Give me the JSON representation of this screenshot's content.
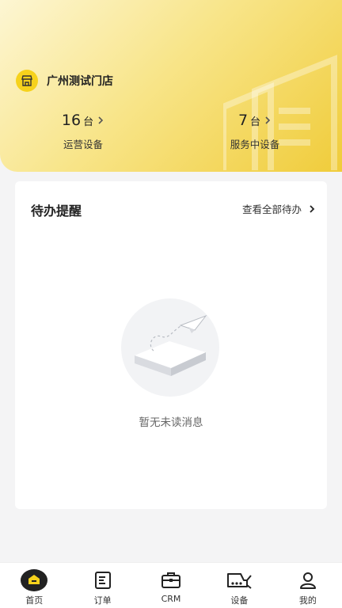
{
  "store": {
    "name": "广州测试门店",
    "icon": "store-icon"
  },
  "stats": [
    {
      "value": "16",
      "unit": "台",
      "label": "运营设备"
    },
    {
      "value": "7",
      "unit": "台",
      "label": "服务中设备"
    }
  ],
  "reminders": {
    "title": "待办提醒",
    "view_all": "查看全部待办",
    "empty_text": "暂无未读消息"
  },
  "tabbar": {
    "items": [
      {
        "label": "首页",
        "icon": "home-icon",
        "active": true
      },
      {
        "label": "订单",
        "icon": "order-icon"
      },
      {
        "label": "CRM",
        "icon": "briefcase-icon"
      },
      {
        "label": "设备",
        "icon": "device-icon"
      },
      {
        "label": "我的",
        "icon": "profile-icon"
      }
    ]
  },
  "colors": {
    "accent": "#f6d21c",
    "header_start": "#fdf6d3",
    "header_end": "#f0cc3a"
  }
}
